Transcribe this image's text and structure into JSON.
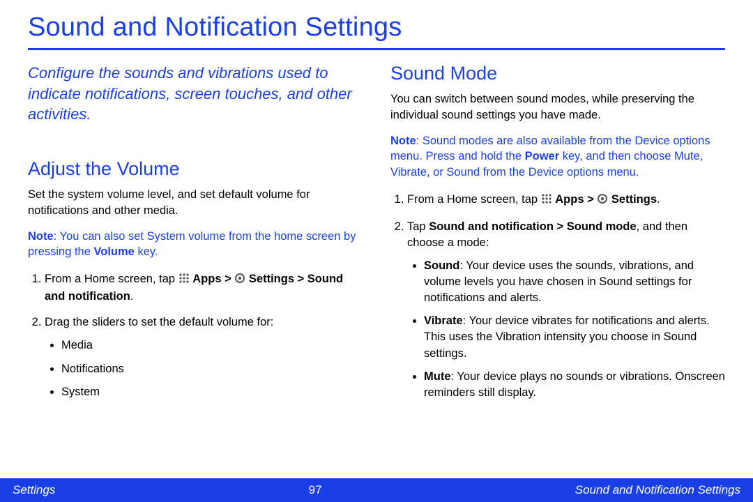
{
  "title": "Sound and Notification Settings",
  "intro": "Configure the sounds and vibrations used to indicate notifications, screen touches, and other activities.",
  "left": {
    "heading": "Adjust the Volume",
    "p1": "Set the system volume level, and set default volume for notifications and other media.",
    "note_prefix": "Note",
    "note_body": ": You can also set System volume from the home screen by pressing the ",
    "note_bold": "Volume",
    "note_tail": " key.",
    "step1_a": "From a Home screen, tap ",
    "step1_apps": " Apps > ",
    "step1_settings": " Settings > Sound and notification",
    "step1_tail": ".",
    "step2": "Drag the sliders to set the default volume for:",
    "bullets": {
      "b1": "Media",
      "b2": "Notifications",
      "b3": "System"
    }
  },
  "right": {
    "heading": "Sound Mode",
    "p1": "You can switch between sound modes, while preserving the individual sound settings you have made.",
    "note_prefix": "Note",
    "note_body1": ": Sound modes are also available from the Device options menu. Press and hold the ",
    "note_bold": "Power",
    "note_body2": " key, and then choose Mute, Vibrate, or Sound from the Device options menu.",
    "step1_a": "From a Home screen, tap ",
    "step1_apps": " Apps > ",
    "step1_settings": " Settings",
    "step1_tail": ".",
    "step2_a": "Tap ",
    "step2_b": "Sound and notification > Sound mode",
    "step2_c": ", and then choose a mode:",
    "modes": {
      "m1_label": "Sound",
      "m1_text": ": Your device uses the sounds, vibrations, and volume levels you have chosen in Sound settings for notifications and alerts.",
      "m2_label": "Vibrate",
      "m2_text": ": Your device vibrates for notifications and alerts. This uses the Vibration intensity you choose in Sound settings.",
      "m3_label": "Mute",
      "m3_text": ": Your device plays no sounds or vibrations. Onscreen reminders still display."
    }
  },
  "footer": {
    "left": "Settings",
    "center": "97",
    "right": "Sound and Notification Settings"
  }
}
